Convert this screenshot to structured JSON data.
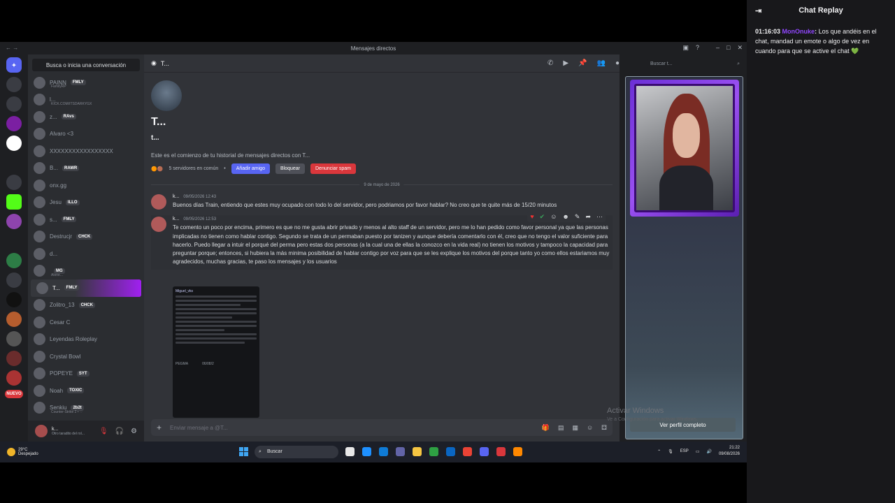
{
  "window": {
    "title": "Mensajes directos"
  },
  "dm_sidebar": {
    "search_label": "Busca o inicia una conversación",
    "items": [
      {
        "name": "PAINN",
        "tag": "FMLY",
        "sub": "FamilyRP"
      },
      {
        "name": "l...",
        "tag": "",
        "sub": "KICK.COM/ITSDARKYGX"
      },
      {
        "name": "z...",
        "tag": "RAvs",
        "sub": ""
      },
      {
        "name": "Alvaro <3",
        "tag": "",
        "sub": ""
      },
      {
        "name": "XXXXXXXXXXXXXXXXX",
        "tag": "",
        "sub": ""
      },
      {
        "name": "B...",
        "tag": "RAWR",
        "sub": ""
      },
      {
        "name": "onx.gg",
        "tag": "",
        "sub": ""
      },
      {
        "name": "Jesu",
        "tag": "ILLO",
        "sub": ""
      },
      {
        "name": "s...",
        "tag": "FMLY",
        "sub": ""
      },
      {
        "name": "Destrucjr",
        "tag": "CHCK",
        "sub": ""
      },
      {
        "name": "d...",
        "tag": "",
        "sub": ""
      },
      {
        "name": "",
        "tag": "MG",
        "sub": "Alone..."
      },
      {
        "name": "T...",
        "tag": "FMLY",
        "sub": ""
      },
      {
        "name": "Zolitro_13",
        "tag": "CHCK",
        "sub": ""
      },
      {
        "name": "Cesar C",
        "tag": "",
        "sub": ""
      },
      {
        "name": "Leyendas Roleplay",
        "tag": "",
        "sub": ""
      },
      {
        "name": "Crystal Bowl",
        "tag": "",
        "sub": ""
      },
      {
        "name": "POPEYE",
        "tag": "SYT",
        "sub": ""
      },
      {
        "name": "Noah",
        "tag": "TOXIC",
        "sub": ""
      },
      {
        "name": "Senkiu",
        "tag": "2b2t",
        "sub": "Counter-Strike 2 • ♡"
      }
    ],
    "user": {
      "name": "k...",
      "status": "Otro taradito del rol..."
    }
  },
  "guilds": {
    "icons": [
      "discord-home",
      "server",
      "server",
      "MKO",
      "server",
      "ks",
      "server",
      "kick",
      "server",
      "EsdCám",
      "server",
      "server",
      "server",
      "server",
      "server",
      "server",
      "server"
    ],
    "new_badge": "NUEVO"
  },
  "chat": {
    "channel_name": "T...",
    "profile_name": "T...",
    "handle": "t...",
    "intro": "Este es el comienzo de tu historial de mensajes directos con T...",
    "mutual_servers": "5 servidores en común",
    "add_friend": "Añadir amigo",
    "block": "Bloquear",
    "report_spam": "Denunciar spam",
    "date_divider": "9 de mayo de 2026",
    "search_placeholder": "Buscar t...",
    "composer_placeholder": "Enviar mensaje a @T...",
    "messages": [
      {
        "author": "k...",
        "time": "09/05/2026 12:43",
        "text": "Buenos días Train, entiendo que estes muy ocupado con todo lo del servidor, pero podriamos por favor hablar? No creo que te quite más de 15/20 minutos"
      },
      {
        "author": "k...",
        "time": "09/05/2026 12:53",
        "text": "Te comento un poco por encima, primero es que no me gusta abrir privado y menos al alto staff de un servidor, pero me lo han pedido como favor personal ya que las personas implicadas no tienen como hablar contigo. Segundo se trata de un permaban puesto por tanizen y aunque debería comentarlo con él, creo que no tengo el valor suficiente para hacerlo. Puedo llegar a intuir el porqué del perma pero estas dos personas (a la cual una de ellas la conozco en la vida real) no tienen los motivos y tampoco la capacidad para preguntar porque; entonces, si hubiera la más minima posibilidad de hablar contigo por voz para que se les explique los motivos del porque tanto yo como ellos estariamos muy agradecidos, muchas gracias, te paso los mensajes y los usuarios"
      }
    ],
    "attachment": {
      "name": "Miguel_vks",
      "label1": "PEGMA",
      "label2": "06/08/2"
    }
  },
  "profile_panel": {
    "view_full_profile": "Ver perfil completo"
  },
  "windows_watermark": {
    "line1": "Activar Windows",
    "line2": "Ve a Configuración para activar Windows."
  },
  "taskbar": {
    "weather_temp": "29°C",
    "weather_desc": "Despejado",
    "search_label": "Buscar",
    "language": "ESP",
    "time": "21:22",
    "date": "09/08/2026",
    "app_colors": [
      "#e8e8e8",
      "#1e90ff",
      "#0f7bd6",
      "#6264a7",
      "#f5c542",
      "#2ea043",
      "#0a66c2",
      "#ea4335",
      "#5865f2",
      "#da373c",
      "#ff8800"
    ]
  },
  "chat_replay": {
    "title": "Chat Replay",
    "messages": [
      {
        "time": "01:16:03",
        "user": "MonOnuke",
        "text": "Los que andéis en el chat, mandad un emote o algo de vez en cuando para que se active el chat",
        "emoji": "💚"
      }
    ]
  }
}
